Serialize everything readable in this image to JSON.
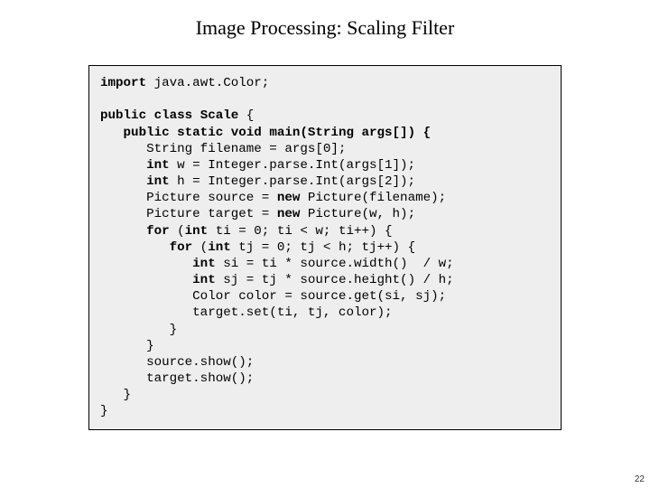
{
  "title": "Image Processing:  Scaling Filter",
  "page_number": "22",
  "code": {
    "l01a": "import",
    "l01b": " java.awt.Color;",
    "blank1": "",
    "l02a": "public class ",
    "l02b": "Scale",
    "l02c": " {",
    "l03a": "   public static void ",
    "l03b": "main",
    "l03c": "(String args[]) {",
    "l04": "      String filename = args[0];",
    "l05a": "      int",
    "l05b": " w = Integer.parse.Int(args[1]);",
    "l06a": "      int",
    "l06b": " h = Integer.parse.Int(args[2]);",
    "l07a": "      Picture source = ",
    "l07b": "new",
    "l07c": " Picture(filename);",
    "l08a": "      Picture target = ",
    "l08b": "new",
    "l08c": " Picture(w, h);",
    "l09a": "      for",
    "l09b": " (",
    "l09c": "int",
    "l09d": " ti = 0; ti < w; ti++) {",
    "l10a": "         for",
    "l10b": " (",
    "l10c": "int",
    "l10d": " tj = 0; tj < h; tj++) {",
    "l11a": "            int",
    "l11b": " si = ti * source.width()  / w;",
    "l12a": "            int",
    "l12b": " sj = tj * source.height() / h;",
    "l13": "            Color color = source.get(si, sj);",
    "l14": "            target.set(ti, tj, color);",
    "l15": "         }",
    "l16": "      }",
    "l17": "      source.show();",
    "l18": "      target.show();",
    "l19": "   }",
    "l20": "}"
  }
}
